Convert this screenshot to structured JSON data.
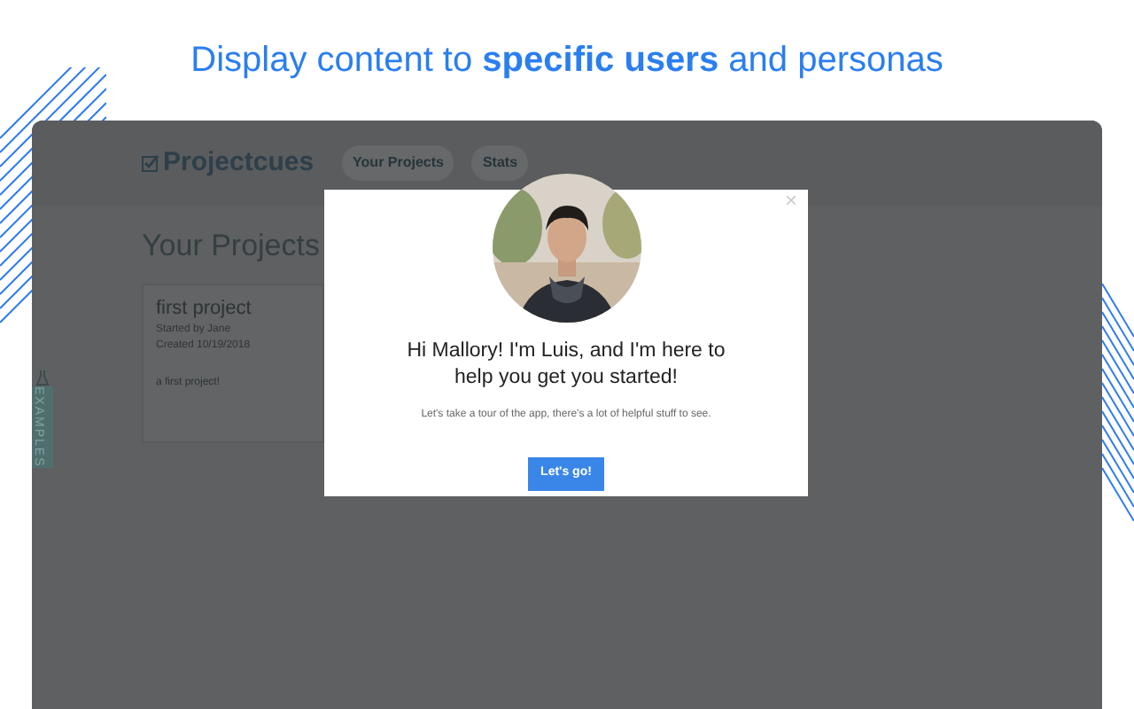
{
  "headline": "Display content to **specific users** and personas",
  "app": {
    "logo": "Projectcues",
    "nav": [
      {
        "label": "Your Projects"
      },
      {
        "label": "Stats"
      }
    ],
    "heading": "Your Projects",
    "card": {
      "title": "first project",
      "started": "Started by Jane",
      "created": "Created 10/19/2018",
      "description": "a first project!"
    },
    "side_tab": "EXAMPLES"
  },
  "modal": {
    "close": "×",
    "title": "Hi Mallory! I'm Luis, and I'm here to help you get you started!",
    "subtitle": "Let's take a tour of the app, there's a lot of helpful stuff to see.",
    "button": "Let's go!"
  }
}
